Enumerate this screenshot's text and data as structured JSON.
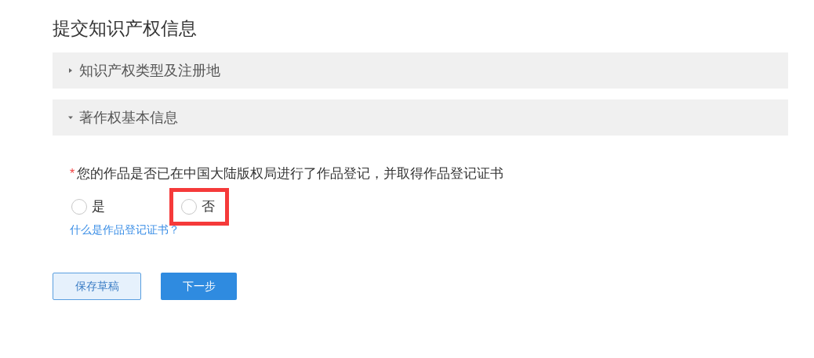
{
  "title": "提交知识产权信息",
  "sections": [
    {
      "label": "知识产权类型及注册地",
      "expanded": false
    },
    {
      "label": "著作权基本信息",
      "expanded": true
    }
  ],
  "question": {
    "label": "您的作品是否已在中国大陆版权局进行了作品登记，并取得作品登记证书",
    "required": true,
    "mark": "*",
    "options": [
      {
        "label": "是",
        "selected": false,
        "highlighted": false
      },
      {
        "label": "否",
        "selected": false,
        "highlighted": true
      }
    ],
    "help_link": "什么是作品登记证书？"
  },
  "buttons": [
    {
      "label": "保存草稿",
      "kind": "secondary"
    },
    {
      "label": "下一步",
      "kind": "primary"
    }
  ]
}
